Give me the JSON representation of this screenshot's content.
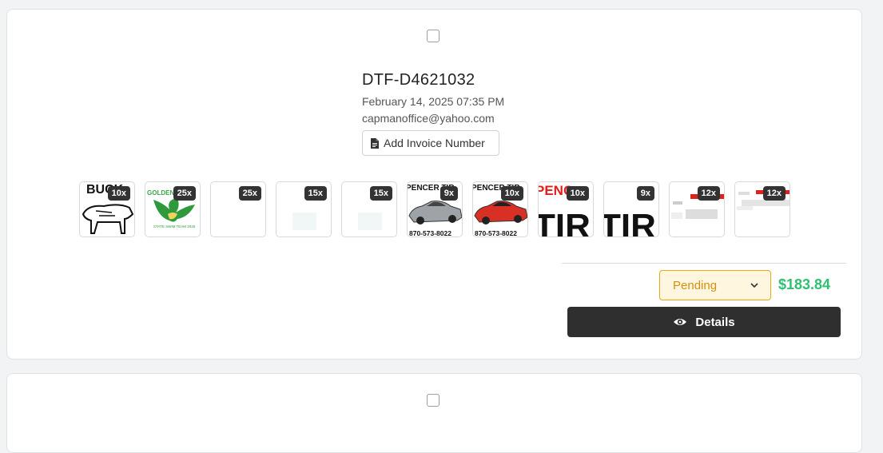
{
  "orders": [
    {
      "id": "DTF-D4621032",
      "date": "February 14, 2025 07:35 PM",
      "email": "capmanoffice@yahoo.com",
      "invoice_button": "Add Invoice Number",
      "thumbnails": [
        {
          "qty": "10x",
          "art": "bull",
          "text": "BUCK"
        },
        {
          "qty": "25x",
          "art": "eagle",
          "text": "GOLDEN",
          "subtext": "STATE SWIM TEAM 2025"
        },
        {
          "qty": "25x",
          "art": "blank"
        },
        {
          "qty": "15x",
          "art": "faint"
        },
        {
          "qty": "15x",
          "art": "faint"
        },
        {
          "qty": "9x",
          "art": "car-silver",
          "text": "PENCER TIR",
          "phone": "870-573-8022"
        },
        {
          "qty": "10x",
          "art": "car-red",
          "text": "PENCER TIR",
          "phone": "870-573-8022"
        },
        {
          "qty": "10x",
          "art": "tire-red",
          "text": "PENC",
          "text2": "TIR"
        },
        {
          "qty": "9x",
          "art": "tire",
          "text2": "TIR"
        },
        {
          "qty": "12x",
          "art": "splash"
        },
        {
          "qty": "12x",
          "art": "splash2"
        }
      ],
      "status": "Pending",
      "price": "$183.84",
      "details_button": "Details"
    }
  ],
  "colors": {
    "status_text": "#d48f0b",
    "status_border": "#e6a817",
    "status_bg": "#fff6e0",
    "price": "#2fbf71",
    "details_bg": "#2f2f2f"
  }
}
